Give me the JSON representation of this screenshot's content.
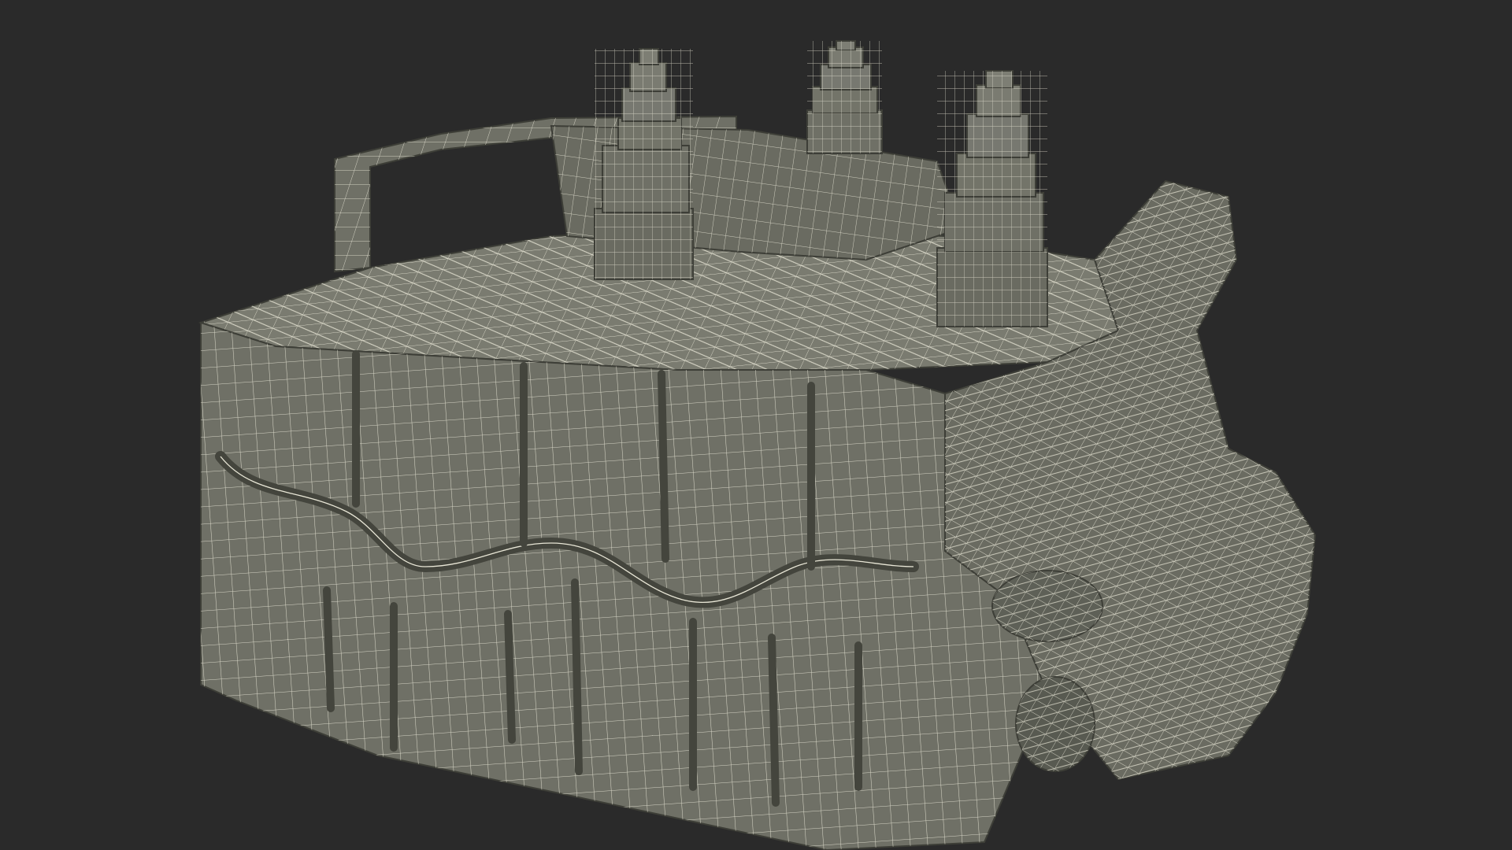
{
  "scene": {
    "background_color": "#2a2a2a",
    "model": {
      "subject": "stone-block-ruin-with-stepped-towers",
      "render_style": "wireframe-over-shaded",
      "surface_color": "#6f7066",
      "surface_dark_color": "#55574e",
      "surface_light_color": "#85877c",
      "wire_color": "#e8e6d6",
      "tower_count": 3
    }
  }
}
